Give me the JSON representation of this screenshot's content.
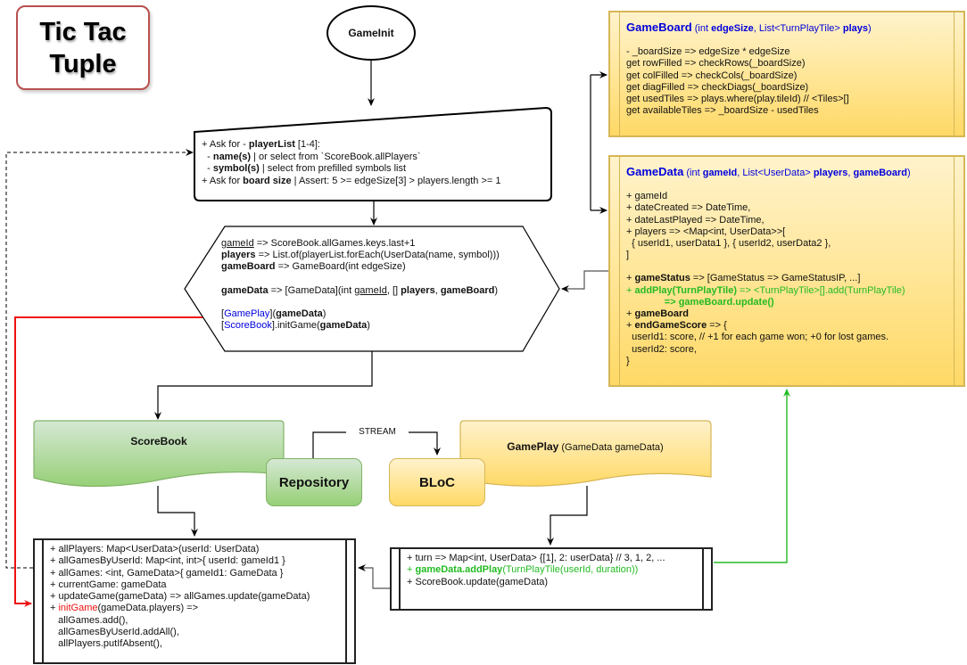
{
  "title": {
    "text": "Tic Tac\nTuple"
  },
  "start_node": {
    "label": "GameInit"
  },
  "input_step": {
    "lines": [
      {
        "prefix": "+ Ask for - ",
        "bold": "playerList",
        "suffix": " [1-4]:"
      },
      {
        "prefix": "  - ",
        "bold": "name(s)",
        "suffix": " | or select from `ScoreBook.allPlayers`"
      },
      {
        "prefix": "  - ",
        "bold": "symbol(s)",
        "suffix": " | select from prefilled symbols list"
      },
      {
        "prefix": "+ Ask for ",
        "bold": "board size",
        "suffix": " | Assert: 5 >= edgeSize[3] > players.length >= 1"
      }
    ]
  },
  "prepare_step": {
    "l1_name": "gameId",
    "l1_rest": " => ScoreBook.allGames.keys.last+1",
    "l2_name": "players",
    "l2_rest": " => List.of(playerList.forEach(UserData(name, symbol)))",
    "l3_name": "gameBoard",
    "l3_rest": " => GameBoard(int edgeSize)",
    "l4_name": "gameData",
    "l4_mid": " => [GameData](int ",
    "l4_u": "gameId",
    "l4_mid2": ", [] ",
    "l4_b1": "players",
    "l4_sep": ", ",
    "l4_b2": "gameBoard",
    "l4_end": ")",
    "l5_open": "[",
    "l5_link": "GamePlay",
    "l5_close": "](",
    "l5_arg": "gameData",
    "l5_end": ")",
    "l6_open": "[",
    "l6_link": "ScoreBook",
    "l6_close": "].initGame(",
    "l6_arg": "gameData",
    "l6_end": ")"
  },
  "gameboard_class": {
    "name": "GameBoard",
    "sig_open": " (int ",
    "sig_b1": "edgeSize",
    "sig_mid": ", List<TurnPlayTile> ",
    "sig_b2": "plays",
    "sig_close": ")",
    "members": [
      "- _boardSize => edgeSize * edgeSize",
      "get rowFilled => checkRows(_boardSize)",
      "get colFilled => checkCols(_boardSize)",
      "get diagFilled => checkDiags(_boardSize)",
      "get usedTiles => plays.where(play.tileId) // <Tiles>[]",
      "get availableTiles => _boardSize - usedTiles"
    ]
  },
  "gamedata_class": {
    "name": "GameData",
    "sig_open": " (int ",
    "sig_b1": "gameId",
    "sig_mid": ", List<UserData> ",
    "sig_b2": "players",
    "sig_sep": ", ",
    "sig_b3": "gameBoard",
    "sig_close": ")",
    "members_a": [
      "+ gameId",
      "+ dateCreated => DateTime,",
      "+ dateLastPlayed => DateTime,",
      "+ players => <Map<int, UserData>>[",
      "  { userId1, userData1 }, { userId2, userData2 },",
      "]"
    ],
    "status_prefix": "+ ",
    "status_bold": "gameStatus",
    "status_rest": " => [GameStatus => GameStatusIP, ...]",
    "addplay_prefix": "+ ",
    "addplay_bold": "addPlay(TurnPlayTile)",
    "addplay_rest": " => <TurnPlayTile>[].add(TurnPlayTile)",
    "addplay_cont_prefix": "              => ",
    "addplay_cont_bold": "gameBoard.update()",
    "gameboard_prefix": "+ ",
    "gameboard_bold": "gameBoard",
    "endscore_prefix": "+ ",
    "endscore_bold": "endGameScore",
    "endscore_rest": " => {",
    "members_b": [
      "  userId1: score, // +1 for each game won; +0 for lost games.",
      "  userId2: score,",
      "}"
    ]
  },
  "components": {
    "scorebook": "ScoreBook",
    "repository": "Repository",
    "stream": "STREAM",
    "bloc": "BLoC",
    "gameplay_name": "GamePlay",
    "gameplay_sig": " (GameData gameData)"
  },
  "scorebook_box": {
    "members_a": [
      "+ allPlayers: Map<UserData>(userId: UserData)",
      "+ allGamesByUserId: Map<int, int>{ userId: gameId1 }",
      "+ allGames: <int, GameData>{ gameId1: GameData }",
      "+ currentGame: gameData",
      "+ updateGame(gameData) => allGames.update(gameData)"
    ],
    "init_prefix": "+ ",
    "init_red": "initGame",
    "init_rest": "(gameData.players) =>",
    "members_b": [
      "   allGames.add(),",
      "   allGamesByUserId.addAll(),",
      "   allPlayers.putIfAbsent(),"
    ]
  },
  "gameplay_box": {
    "turn": "+ turn => Map<int, UserData> {[1], 2: userData} // 3, 1, 2, ...",
    "addplay_prefix": "+ ",
    "addplay_bold": "gameData.addPlay",
    "addplay_rest": "(TurnPlayTile(userId, duration))",
    "update": "+ ScoreBook.update(gameData)"
  },
  "colors": {
    "red_flow": "#ee1111",
    "green_flow": "#22bb22",
    "yellow_fill": "#ffd966",
    "green_fill": "#97d077",
    "link_blue": "#0000dd"
  }
}
